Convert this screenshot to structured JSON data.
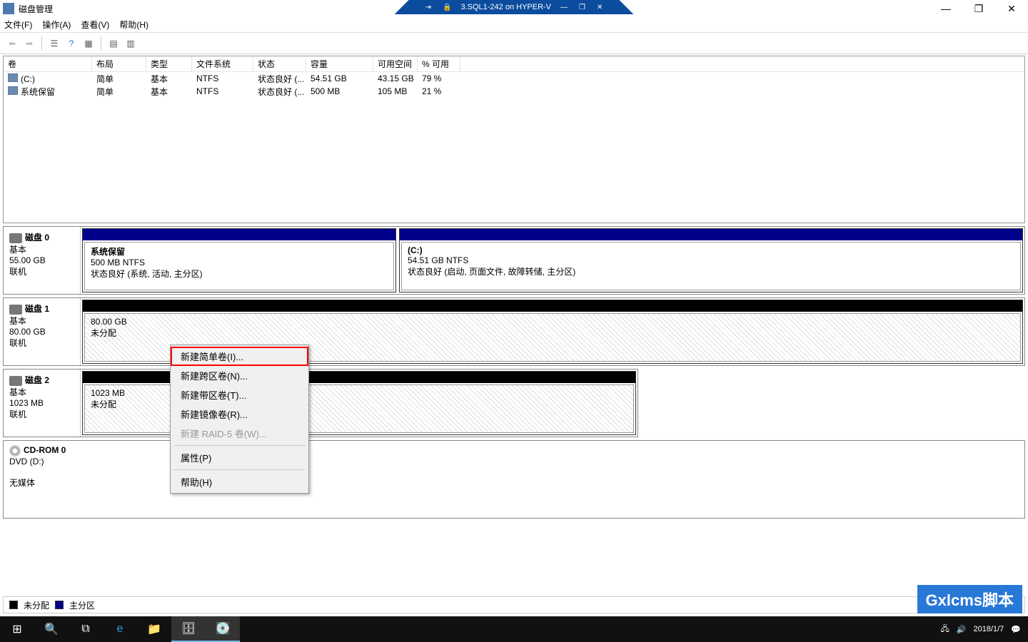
{
  "title": "磁盘管理",
  "vm_banner": "3.SQL1-242 on HYPER-V",
  "menu": {
    "file": "文件(F)",
    "action": "操作(A)",
    "view": "查看(V)",
    "help": "帮助(H)"
  },
  "volume_headers": {
    "volume": "卷",
    "layout": "布局",
    "type": "类型",
    "fs": "文件系统",
    "status": "状态",
    "capacity": "容量",
    "free": "可用空间",
    "pct": "% 可用"
  },
  "volumes": [
    {
      "name": "(C:)",
      "layout": "简单",
      "type": "基本",
      "fs": "NTFS",
      "status": "状态良好 (...",
      "capacity": "54.51 GB",
      "free": "43.15 GB",
      "pct": "79 %"
    },
    {
      "name": "系统保留",
      "layout": "简单",
      "type": "基本",
      "fs": "NTFS",
      "status": "状态良好 (...",
      "capacity": "500 MB",
      "free": "105 MB",
      "pct": "21 %"
    }
  ],
  "disks": {
    "d0": {
      "title": "磁盘 0",
      "type": "基本",
      "size": "55.00 GB",
      "state": "联机",
      "parts": [
        {
          "title": "系统保留",
          "line2": "500 MB NTFS",
          "line3": "状态良好 (系统, 活动, 主分区)"
        },
        {
          "title": "(C:)",
          "line2": "54.51 GB NTFS",
          "line3": "状态良好 (启动, 页面文件, 故障转储, 主分区)"
        }
      ]
    },
    "d1": {
      "title": "磁盘 1",
      "type": "基本",
      "size": "80.00 GB",
      "state": "联机",
      "parts": [
        {
          "line2": "80.00 GB",
          "line3": "未分配"
        }
      ]
    },
    "d2": {
      "title": "磁盘 2",
      "type": "基本",
      "size": "1023 MB",
      "state": "联机",
      "parts": [
        {
          "line2": "1023 MB",
          "line3": "未分配"
        }
      ]
    },
    "cd": {
      "title": "CD-ROM 0",
      "line2": "DVD (D:)",
      "line3": "无媒体"
    }
  },
  "legend": {
    "unalloc": "未分配",
    "primary": "主分区"
  },
  "context_menu": {
    "simple": "新建简单卷(I)...",
    "span": "新建跨区卷(N)...",
    "stripe": "新建带区卷(T)...",
    "mirror": "新建镜像卷(R)...",
    "raid5": "新建 RAID-5 卷(W)...",
    "props": "属性(P)",
    "help": "帮助(H)"
  },
  "tray": {
    "date": "2018/1/7"
  },
  "watermark": "Gxlcms脚本"
}
